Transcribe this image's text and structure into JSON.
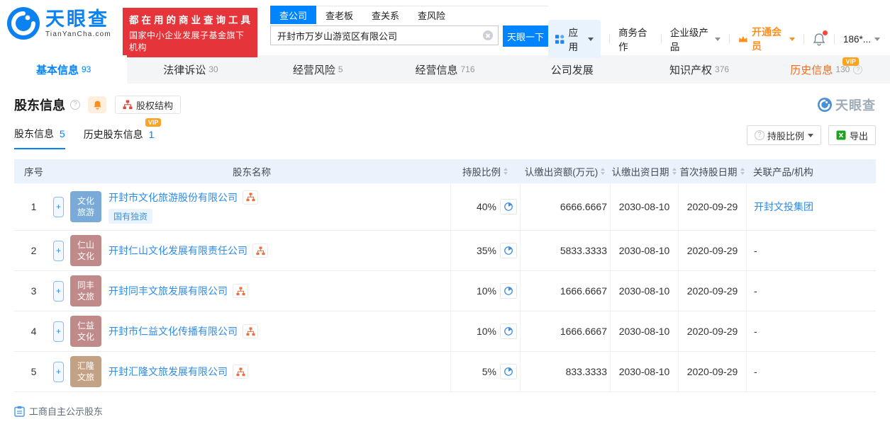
{
  "strings": {
    "vip": "VIP",
    "plus": "+",
    "question": "?"
  },
  "colors": {
    "primary": "#0084ff",
    "orange": "#ff8f1f",
    "banner_red": "#e5353a",
    "link": "#2f8be5"
  },
  "header": {
    "logo": {
      "text": "天眼查",
      "domain": "TianYanCha.com"
    },
    "banner": {
      "line1": "都在用的商业查询工具",
      "line2": "国家中小企业发展子基金旗下机构"
    },
    "search": {
      "tabs": [
        {
          "label": "查公司"
        },
        {
          "label": "查老板"
        },
        {
          "label": "查关系"
        },
        {
          "label": "查风险"
        }
      ],
      "value": "开封市万岁山游览区有限公司",
      "button": "天眼一下"
    },
    "menu": {
      "apps": "应用",
      "cooperation": "商务合作",
      "enterprise": "企业级产品",
      "vip": "开通会员",
      "phone": "186*..."
    }
  },
  "nav_tabs": [
    {
      "label": "基本信息",
      "count": "93"
    },
    {
      "label": "法律诉讼",
      "count": "30"
    },
    {
      "label": "经营风险",
      "count": "5"
    },
    {
      "label": "经营信息",
      "count": "716"
    },
    {
      "label": "公司发展",
      "count": ""
    },
    {
      "label": "知识产权",
      "count": "376"
    },
    {
      "label": "历史信息",
      "count": "130"
    }
  ],
  "section": {
    "title": "股东信息",
    "equity_structure": "股权结构",
    "watermark": "天眼查",
    "subtabs": {
      "current": {
        "label": "股东信息",
        "count": "5"
      },
      "history": {
        "label": "历史股东信息",
        "count": "1"
      }
    },
    "controls": {
      "ratio": "持股比例",
      "export": "导出"
    },
    "footnote": "工商自主公示股东"
  },
  "table": {
    "columns": {
      "seq": "序号",
      "name": "股东名称",
      "ratio": "持股比例",
      "amount": "认缴出资额(万元)",
      "due_date": "认缴出资日期",
      "first_date": "首次持股日期",
      "related": "关联产品/机构"
    },
    "rows": [
      {
        "seq": "1",
        "avatar": {
          "line1": "文化",
          "line2": "旅游",
          "color": "#7aabd8"
        },
        "name": "开封市文化旅游股份有限公司",
        "tag": "国有独资",
        "ratio": "40%",
        "amount": "6666.6667",
        "due_date": "2030-08-10",
        "first_date": "2020-09-29",
        "related": "开封文投集团"
      },
      {
        "seq": "2",
        "avatar": {
          "line1": "仁山",
          "line2": "文化",
          "color": "#c08a8a"
        },
        "name": "开封仁山文化发展有限责任公司",
        "ratio": "35%",
        "amount": "5833.3333",
        "due_date": "2030-08-10",
        "first_date": "2020-09-29",
        "related": "-"
      },
      {
        "seq": "3",
        "avatar": {
          "line1": "同丰",
          "line2": "文旅",
          "color": "#c08a8a"
        },
        "name": "开封同丰文旅发展有限公司",
        "ratio": "10%",
        "amount": "1666.6667",
        "due_date": "2030-08-10",
        "first_date": "2020-09-29",
        "related": "-"
      },
      {
        "seq": "4",
        "avatar": {
          "line1": "仁益",
          "line2": "文化",
          "color": "#c08a8a"
        },
        "name": "开封市仁益文化传播有限公司",
        "ratio": "10%",
        "amount": "1666.6667",
        "due_date": "2030-08-10",
        "first_date": "2020-09-29",
        "related": "-"
      },
      {
        "seq": "5",
        "avatar": {
          "line1": "汇隆",
          "line2": "文旅",
          "color": "#c3a184 "
        },
        "name": "开封汇隆文旅发展有限公司",
        "ratio": "5%",
        "amount": "833.3333",
        "due_date": "2030-08-10",
        "first_date": "2020-09-29",
        "related": "-"
      }
    ]
  }
}
